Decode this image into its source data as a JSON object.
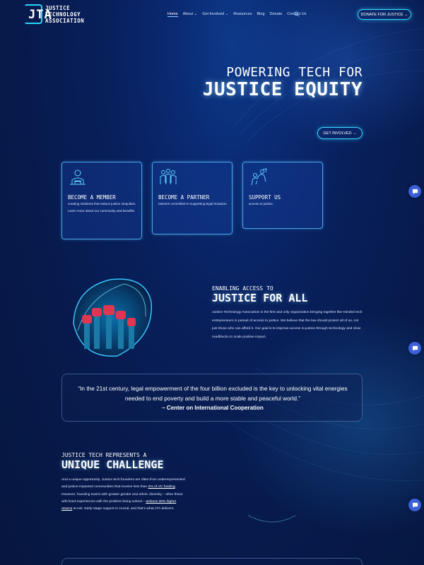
{
  "header": {
    "logo_mark": "JTA",
    "logo_name_lines": [
      "JUSTICE",
      "TECHNOLOGY",
      "ASSOCIATION"
    ],
    "nav": [
      "Home",
      "About",
      "Get Involved",
      "Resources",
      "Blog",
      "Donate",
      "Contact Us"
    ],
    "donate_button": "DONATE FOR JUSTICE →"
  },
  "hero": {
    "subtitle": "POWERING TECH FOR",
    "title": "JUSTICE EQUITY",
    "cta": "GET INVOLVED →"
  },
  "cards": [
    {
      "title": "BECOME A MEMBER",
      "text": "creating solutions that reduce justice inequities. Learn more about our community and benefits."
    },
    {
      "title": "BECOME A PARTNER",
      "text": "network committed to supporting legal inclusion."
    },
    {
      "title": "SUPPORT US",
      "text": "access to justice."
    }
  ],
  "access": {
    "subtitle": "ENABLING ACCESS TO",
    "title": "JUSTICE FOR ALL",
    "text": "Justice Technology Association is the first and only organization bringing together like-minded tech entrepreneurs in pursuit of access to justice. We believe that the law should protect all of us, not just those who can afford it. Our goal is to improve access to justice through technology and clear roadblocks to scale positive impact."
  },
  "quote": {
    "text": "“In the 21st century, legal empowerment of the four billion excluded is the key to unlocking vital energies needed to end poverty and build a more stable and peaceful world.”",
    "author": "– Center on International Cooperation"
  },
  "challenge": {
    "subtitle": "JUSTICE TECH REPRESENTS A",
    "title": "UNIQUE CHALLENGE",
    "text_before_link1": "And a unique opportunity. Justice tech founders are often from underrepresented and justice-impacted communities that receive less than ",
    "link1": "2% of VC funding",
    "text_between": ". However, founding teams with greater gender and ethnic diversity – often those with lived experiences with the problem being solved – ",
    "link2": "achieve 30% higher returns",
    "text_after": " at exit. Early-stage support is crucial, and that’s what JTA delivers."
  },
  "colors": {
    "accent": "#38d6ff",
    "background": "#071a4c",
    "card_border": "#4aa7e8",
    "chat": "#3a5fd8"
  },
  "icons": [
    "search-icon",
    "member-icon",
    "partner-icon",
    "support-icon",
    "chat-icon"
  ]
}
